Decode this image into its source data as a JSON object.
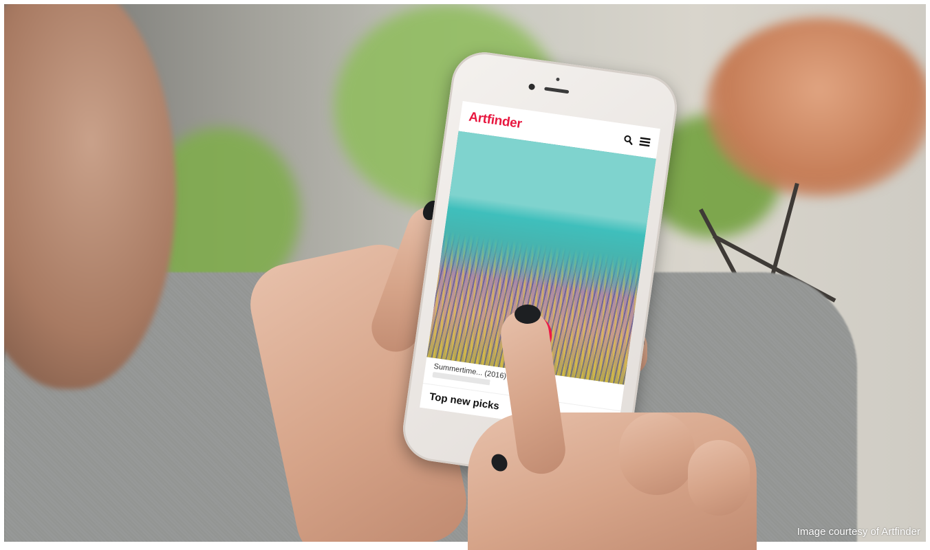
{
  "app": {
    "logo_text": "Artfinder",
    "brand_color": "#e8173f",
    "icons": [
      "search-icon",
      "menu-icon",
      "basket-icon"
    ]
  },
  "artwork": {
    "caption_title": "Summertime... (2016)"
  },
  "section": {
    "title": "Top new picks"
  },
  "photo": {
    "credit": "Image courtesy of Artfinder"
  }
}
